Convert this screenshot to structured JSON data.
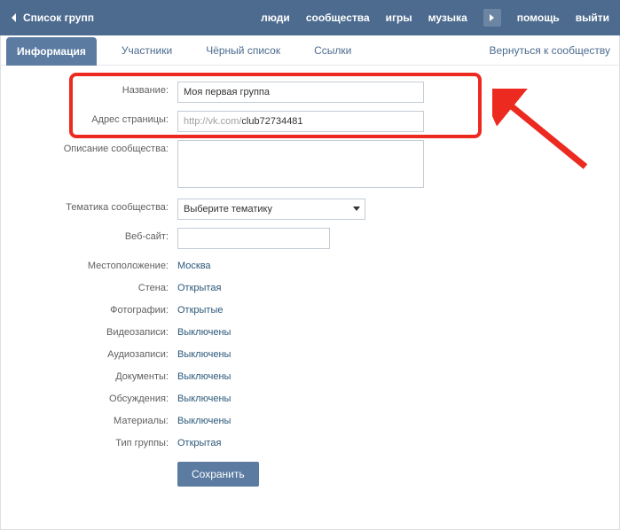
{
  "topbar": {
    "title": "Список групп",
    "nav": {
      "people": "люди",
      "communities": "сообщества",
      "games": "игры",
      "music": "музыка",
      "help": "помощь",
      "logout": "выйти"
    }
  },
  "tabs": {
    "info": "Информация",
    "members": "Участники",
    "blacklist": "Чёрный список",
    "links": "Ссылки",
    "return": "Вернуться к сообществу"
  },
  "labels": {
    "name": "Название:",
    "url": "Адрес страницы:",
    "desc": "Описание сообщества:",
    "topic": "Тематика сообщества:",
    "site": "Веб-сайт:",
    "location": "Местоположение:",
    "wall": "Стена:",
    "photos": "Фотографии:",
    "videos": "Видеозаписи:",
    "audios": "Аудиозаписи:",
    "docs": "Документы:",
    "discuss": "Обсуждения:",
    "materials": "Материалы:",
    "type": "Тип группы:"
  },
  "values": {
    "name": "Моя первая группа",
    "url_prefix": "http://vk.com/",
    "url_slug": "club72734481",
    "desc": "",
    "topic_placeholder": "Выберите тематику",
    "site": "",
    "location": "Москва",
    "wall": "Открытая",
    "photos": "Открытые",
    "videos": "Выключены",
    "audios": "Выключены",
    "docs": "Выключены",
    "discuss": "Выключены",
    "materials": "Выключены",
    "type": "Открытая"
  },
  "buttons": {
    "save": "Сохранить"
  },
  "colors": {
    "primary": "#4c6b8f",
    "annotation": "#ec2a1f"
  }
}
